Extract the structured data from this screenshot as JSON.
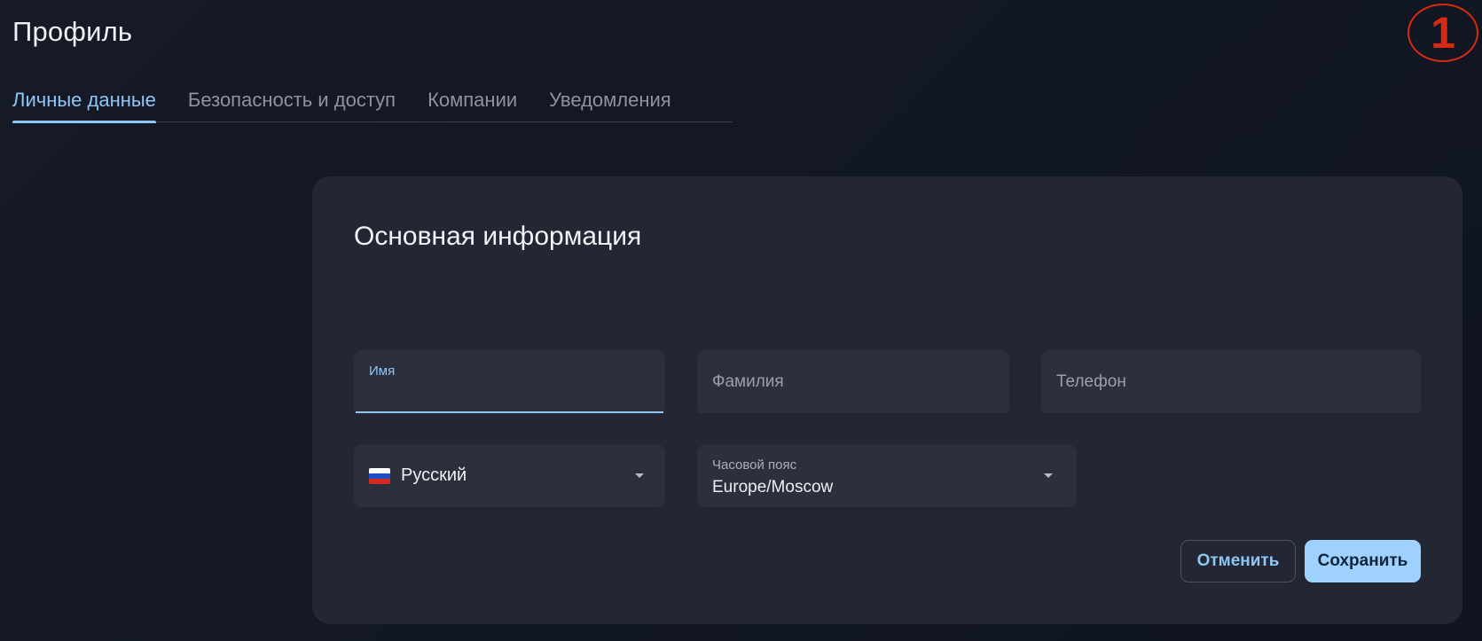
{
  "header": {
    "title": "Профиль",
    "step_badge": "1"
  },
  "tabs": [
    {
      "label": "Личные данные",
      "active": true
    },
    {
      "label": "Безопасность и доступ",
      "active": false
    },
    {
      "label": "Компании",
      "active": false
    },
    {
      "label": "Уведомления",
      "active": false
    }
  ],
  "card": {
    "title": "Основная информация",
    "fields": {
      "first_name": {
        "label": "Имя",
        "value": ""
      },
      "last_name": {
        "placeholder": "Фамилия"
      },
      "phone": {
        "placeholder": "Телефон"
      },
      "language": {
        "value": "Русский",
        "flag_icon": "russia-flag-icon"
      },
      "timezone": {
        "label": "Часовой пояс",
        "value": "Europe/Moscow"
      }
    },
    "actions": {
      "cancel_label": "Отменить",
      "save_label": "Сохранить"
    }
  },
  "colors": {
    "accent": "#8fc6f4",
    "save_button": "#9fd1ff",
    "badge": "#d62a12",
    "card_bg": "#222733",
    "field_bg": "#2b303c"
  }
}
